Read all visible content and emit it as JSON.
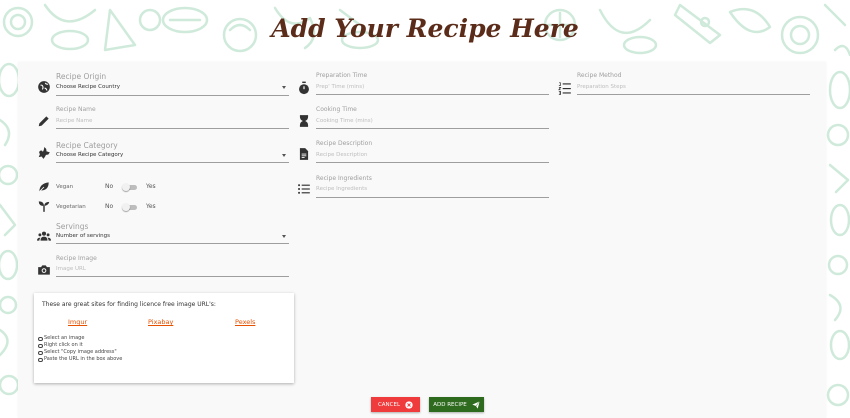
{
  "page": {
    "title": "Add Your Recipe Here"
  },
  "colors": {
    "title": "#5b2c1a",
    "doodle": "#cfeadb",
    "cancel": "#ef3b3b",
    "add": "#2e6b1f",
    "link": "#e65100"
  },
  "form": {
    "origin": {
      "icon": "globe-icon",
      "label": "Recipe Origin",
      "value": "Choose Recipe Country"
    },
    "name": {
      "icon": "pencil-icon",
      "label": "Recipe Name",
      "placeholder": "Recipe Name"
    },
    "category": {
      "icon": "category-icon",
      "label": "Recipe Category",
      "value": "Choose Recipe Category"
    },
    "vegan": {
      "icon": "leaf-icon",
      "label": "Vegan",
      "off_label": "No",
      "on_label": "Yes",
      "checked": false
    },
    "vegetarian": {
      "icon": "sprout-icon",
      "label": "Vegetarian",
      "off_label": "No",
      "on_label": "Yes",
      "checked": false
    },
    "servings": {
      "icon": "people-icon",
      "label": "Servings",
      "value": "Number of servings"
    },
    "image": {
      "icon": "camera-icon",
      "label": "Recipe Image",
      "placeholder": "Image URL"
    },
    "prep_time": {
      "icon": "timer-icon",
      "label": "Preparation Time",
      "placeholder": "Prep' Time (mins)"
    },
    "cook_time": {
      "icon": "hourglass-icon",
      "label": "Cooking Time",
      "placeholder": "Cooking Time (mins)"
    },
    "description": {
      "icon": "document-icon",
      "label": "Recipe Description",
      "placeholder": "Recipe Description"
    },
    "ingredients": {
      "icon": "list-icon",
      "label": "Recipe Ingredients",
      "placeholder": "Recipe Ingredients"
    },
    "method": {
      "icon": "numbered-list-icon",
      "label": "Recipe Method",
      "placeholder": "Preparation Steps"
    }
  },
  "info": {
    "title": "These are great sites for finding licence free image URL's:",
    "links": [
      "Imgur",
      "Pixabay",
      "Pexels"
    ],
    "steps": [
      "Select an image",
      "Right click on it",
      "Select \"Copy image address\"",
      "Paste the URL in the box above"
    ]
  },
  "buttons": {
    "cancel": "CANCEL",
    "cancel_icon": "cancel-circle-icon",
    "add": "ADD RECIPE",
    "add_icon": "send-icon"
  }
}
